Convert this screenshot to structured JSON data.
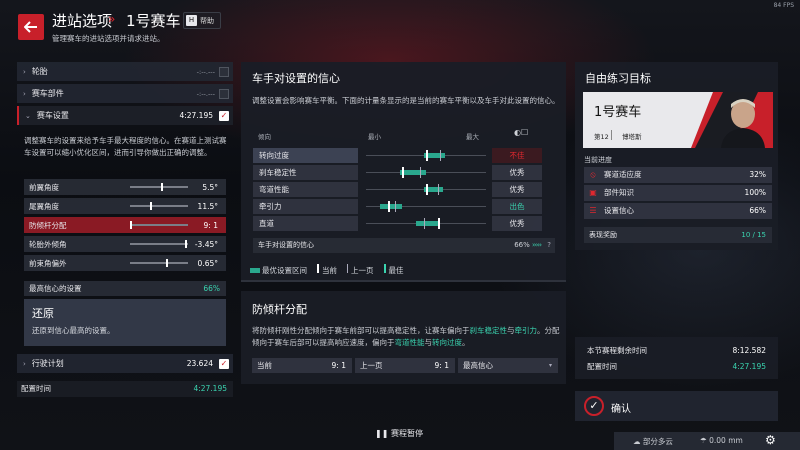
{
  "fps": "84 FPS",
  "header": {
    "title": "进站选项",
    "arrow": "»",
    "car": "1号赛车",
    "help_key": "H",
    "help_label": "帮助",
    "subtitle": "管理赛车的进站选项并请求进站。"
  },
  "left": {
    "rows": [
      {
        "label": "轮胎",
        "value": "-:--.---"
      },
      {
        "label": "赛车部件",
        "value": "-:--.---"
      },
      {
        "label": "赛车设置",
        "value": "4:27.195"
      }
    ],
    "description": "调整赛车的设置来给予车手最大程度的信心。在赛道上测试赛车设置可以缩小优化区间，进而引导你做出正确的调整。",
    "settings": [
      {
        "label": "前翼角度",
        "value": "5.5°",
        "pos": 0.55
      },
      {
        "label": "尾翼角度",
        "value": "11.5°",
        "pos": 0.35
      },
      {
        "label": "防倾杆分配",
        "value": "9: 1",
        "pos": 0.0
      },
      {
        "label": "轮胎外倾角",
        "value": "-3.45°",
        "pos": 0.98
      },
      {
        "label": "前束角偏外",
        "value": "0.65°",
        "pos": 0.65
      }
    ],
    "confidence_label": "最高信心的设置",
    "confidence_value": "66%",
    "restore_title": "还原",
    "restore_desc": "还原到信心最高的设置。",
    "plan_label": "行驶计划",
    "plan_value": "23.624",
    "config_time_label": "配置时间",
    "config_time_value": "4:27.195"
  },
  "center": {
    "title": "车手对设置的信心",
    "description": "调整设置会影响赛车平衡。下面的计量条显示的是当前的赛车平衡以及车手对此设置的信心。",
    "col_trend": "倾向",
    "col_min": "最小",
    "col_max": "最大",
    "rows": [
      {
        "label": "转向过度",
        "rating": "不佳",
        "opt": [
          0.48,
          0.66
        ],
        "cur": 0.5,
        "prev": 0.62
      },
      {
        "label": "刹车稳定性",
        "rating": "优秀",
        "opt": [
          0.28,
          0.5
        ],
        "cur": 0.3,
        "prev": 0.45
      },
      {
        "label": "弯道性能",
        "rating": "优秀",
        "opt": [
          0.48,
          0.64
        ],
        "cur": 0.5,
        "prev": 0.6
      },
      {
        "label": "牵引力",
        "rating": "出色",
        "opt": [
          0.12,
          0.3
        ],
        "cur": 0.18,
        "prev": 0.24
      },
      {
        "label": "直道",
        "rating": "优秀",
        "opt": [
          0.42,
          0.62
        ],
        "cur": 0.6,
        "prev": 0.48
      }
    ],
    "footer_label": "车手对设置的信心",
    "footer_pct": "66%",
    "footer_arrows": "›››››",
    "footer_q": "?",
    "legend": {
      "optimal": "最优设置区间",
      "current": "当前",
      "previous": "上一页",
      "best": "最佳"
    },
    "arb_title": "防倾杆分配",
    "arb_desc_1": "将防倾杆刚性分配倾向于赛车前部可以提高稳定性，让赛车偏向于",
    "arb_hl_1": "刹车稳定性",
    "arb_desc_2": "与",
    "arb_hl_2": "牵引力",
    "arb_desc_3": "。分配倾向于赛车后部可以提高响应速度，偏向于",
    "arb_hl_3": "弯道性能",
    "arb_desc_4": "与",
    "arb_hl_4": "转向过度",
    "arb_desc_5": "。",
    "arb_current_label": "当前",
    "arb_current_value": "9: 1",
    "arb_prev_label": "上一页",
    "arb_prev_value": "9: 1",
    "arb_best_label": "最高信心",
    "pause_label": "赛程暂停"
  },
  "right": {
    "title": "自由练习目标",
    "car_name": "1号赛车",
    "car_number": "第12",
    "driver": "博塔斯",
    "progress_label": "当前进度",
    "progress": [
      {
        "label": "赛道适应度",
        "value": "32%"
      },
      {
        "label": "部件知识",
        "value": "100%"
      },
      {
        "label": "设置信心",
        "value": "66%"
      }
    ],
    "reward_label": "表现奖励",
    "reward_value": "10 / 15",
    "session_remaining_label": "本节赛程剩余时间",
    "session_remaining_value": "8:12.582",
    "config_time_label": "配置时间",
    "config_time_value": "4:27.195",
    "confirm_label": "确认",
    "weather": "部分多云",
    "rain": "0.00 mm"
  },
  "colors": {
    "accent": "#c8202a",
    "teal": "#3ad4b0"
  }
}
